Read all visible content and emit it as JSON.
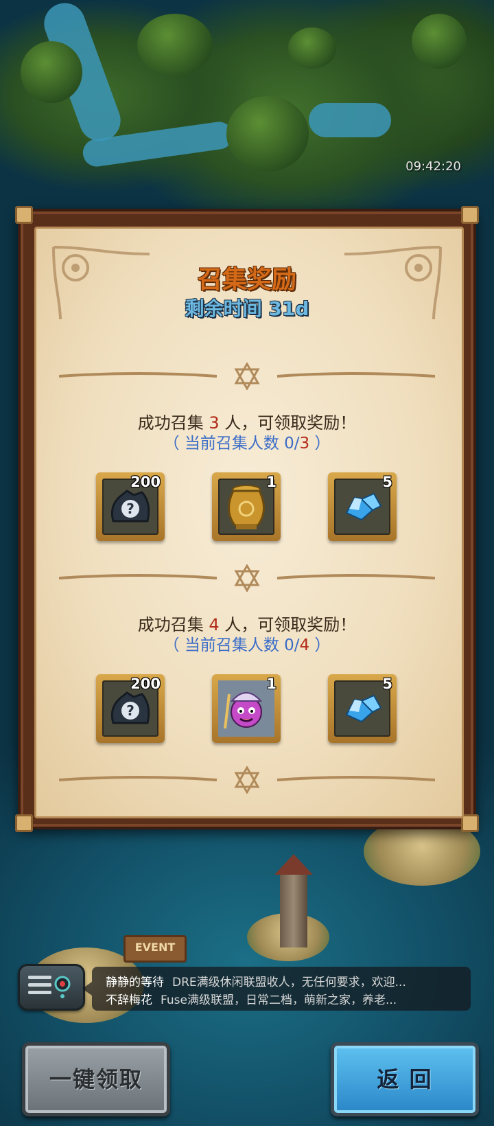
{
  "status": {
    "time": "09:42:20"
  },
  "scene": {
    "event_sign": "EVENT"
  },
  "dialog": {
    "title": "召集奖励",
    "subtitle": "剩余时间 31d",
    "tiers": [
      {
        "req_prefix": "成功召集 ",
        "req_num": "3",
        "req_suffix": " 人，可领取奖励！",
        "prog_prefix": "（ 当前召集人数 0/",
        "prog_num": "3",
        "prog_suffix": " ）",
        "rewards": [
          {
            "icon": "mystery-bag-icon",
            "count": "200"
          },
          {
            "icon": "golden-urn-icon",
            "count": "1"
          },
          {
            "icon": "blue-crystal-icon",
            "count": "5"
          }
        ]
      },
      {
        "req_prefix": "成功召集 ",
        "req_num": "4",
        "req_suffix": " 人，可领取奖励！",
        "prog_prefix": "（ 当前召集人数 0/",
        "prog_num": "4",
        "prog_suffix": " ）",
        "rewards": [
          {
            "icon": "mystery-bag-icon",
            "count": "200"
          },
          {
            "icon": "hero-portrait-icon",
            "count": "1"
          },
          {
            "icon": "blue-crystal-icon",
            "count": "5"
          }
        ]
      }
    ]
  },
  "chat": {
    "icon": "chat-icon",
    "messages": [
      {
        "sender": "静静的等待",
        "text": "DRE满级休闲联盟收人，无任何要求，欢迎..."
      },
      {
        "sender": "不辞梅花",
        "text": "Fuse满级联盟，日常二档，萌新之家，养老..."
      }
    ]
  },
  "buttons": {
    "claim_all": "一键领取",
    "back": "返 回"
  },
  "colors": {
    "title": "#d46a18",
    "subtitle": "#6cb8e0",
    "highlight_num": "#b02a18",
    "progress": "#3a6cc8"
  }
}
